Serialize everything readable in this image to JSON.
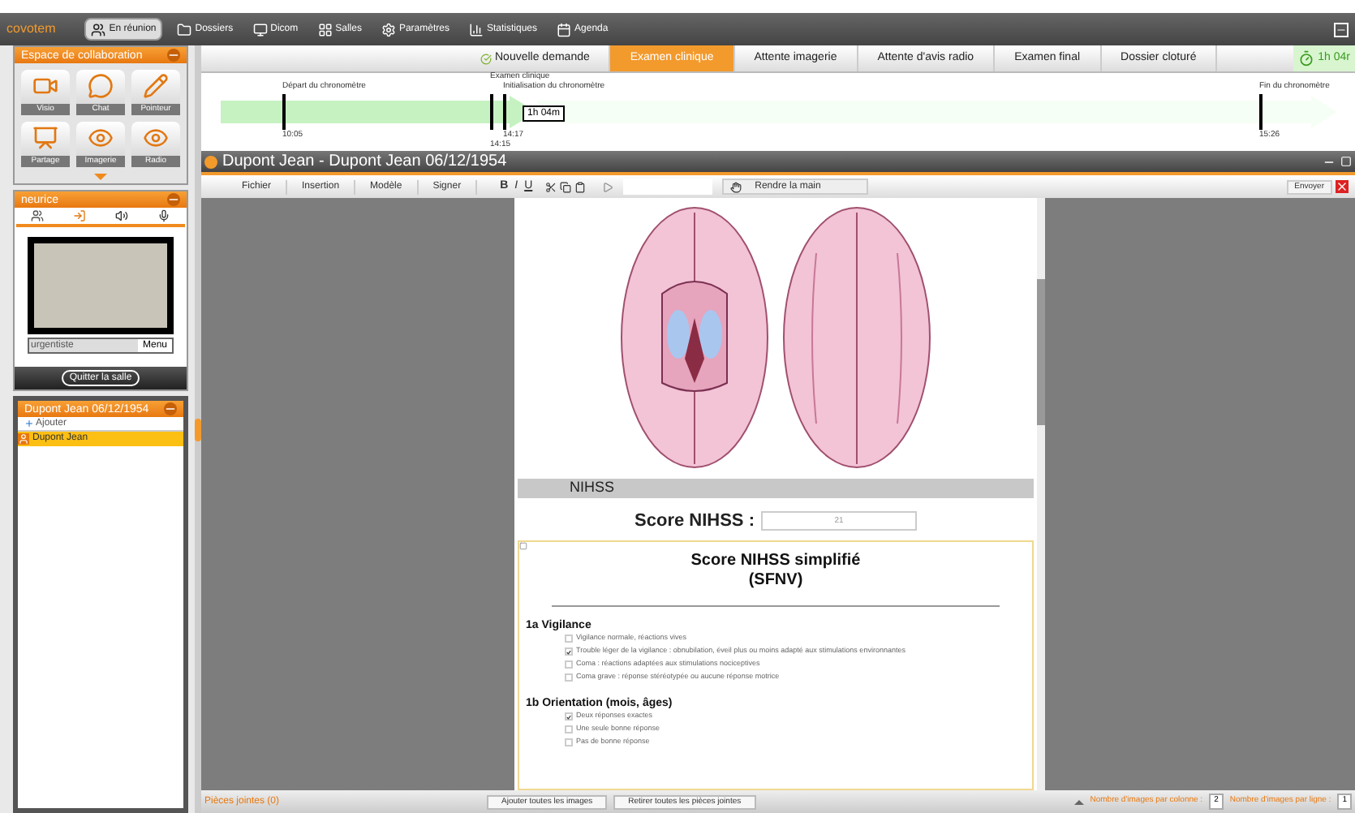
{
  "app": {
    "logo": "covotem"
  },
  "nav": [
    {
      "label": "En réunion",
      "selected": true
    },
    {
      "label": "Dossiers",
      "selected": false
    },
    {
      "label": "Dicom",
      "selected": false
    },
    {
      "label": "Salles",
      "selected": false
    },
    {
      "label": "Paramètres",
      "selected": false
    },
    {
      "label": "Statistiques",
      "selected": false
    },
    {
      "label": "Agenda",
      "selected": false
    }
  ],
  "collab_panel": {
    "title": "Espace de collaboration",
    "tools": [
      {
        "label": "Visio",
        "kind": "video"
      },
      {
        "label": "Chat",
        "kind": "chat"
      },
      {
        "label": "Pointeur",
        "kind": "pen"
      },
      {
        "label": "Partage",
        "kind": "share"
      },
      {
        "label": "Imagerie",
        "kind": "eye"
      },
      {
        "label": "Radio",
        "kind": "eye"
      }
    ]
  },
  "visio_panel": {
    "title": "neurice",
    "participant": "urgentiste",
    "menu_button": "Menu",
    "quit_button": "Quitter la salle"
  },
  "patient_panel": {
    "title": "Dupont Jean 06/12/1954",
    "add": "Ajouter",
    "items": [
      {
        "label": "Dupont Jean",
        "selected": true
      }
    ]
  },
  "workflow": [
    {
      "label": "Nouvelle demande",
      "selected": false,
      "done": true
    },
    {
      "label": "Examen clinique",
      "selected": true,
      "done": false
    },
    {
      "label": "Attente imagerie",
      "selected": false,
      "done": false
    },
    {
      "label": "Attente d'avis radio",
      "selected": false,
      "done": false
    },
    {
      "label": "Examen final",
      "selected": false,
      "done": false
    },
    {
      "label": "Dossier cloturé",
      "selected": false,
      "done": false
    }
  ],
  "timer": "1h 04r",
  "timeline": {
    "duration": "1h 04m",
    "events": [
      {
        "label": "Départ du chronomètre",
        "time": "10:05"
      },
      {
        "label": "Examen clinique",
        "time": "14:15"
      },
      {
        "label": "Initialisation du chronomètre",
        "time": "14:17"
      },
      {
        "label": "Fin du chronomètre",
        "time": "15:26"
      }
    ]
  },
  "document": {
    "title": "Dupont Jean - Dupont Jean 06/12/1954",
    "menus": [
      "Fichier",
      "Insertion",
      "Modèle",
      "Signer"
    ],
    "format_buttons": [
      "B",
      "I",
      "U"
    ],
    "hand_button": "Rendre la main",
    "send_button": "Envoyer",
    "section_title": "NIHSS",
    "score_label": "Score NIHSS :",
    "score_value": "21",
    "form_title": "Score NIHSS simplifié",
    "form_subtitle": "(SFNV)",
    "groups": [
      {
        "title": "1a Vigilance",
        "options": [
          {
            "label": "Vigilance normale, réactions vives",
            "checked": false
          },
          {
            "label": "Trouble léger de la vigilance : obnubilation, éveil plus ou moins adapté aux stimulations environnantes",
            "checked": true
          },
          {
            "label": "Coma : réactions adaptées aux stimulations nociceptives",
            "checked": false
          },
          {
            "label": "Coma grave : réponse stéréotypée ou aucune réponse motrice",
            "checked": false
          }
        ]
      },
      {
        "title": "1b Orientation (mois, âges)",
        "options": [
          {
            "label": "Deux réponses exactes",
            "checked": true
          },
          {
            "label": "Une seule bonne réponse",
            "checked": false
          },
          {
            "label": "Pas de bonne réponse",
            "checked": false
          }
        ]
      }
    ]
  },
  "attachments": {
    "label": "Pièces jointes (0)",
    "buttons": [
      "Ajouter toutes les images",
      "Retirer toutes les pièces jointes"
    ],
    "per_column_label": "Nombre d'images par colonne :",
    "per_column": "2",
    "per_row_label": "Nombre d'images par ligne :",
    "per_row": "1"
  }
}
